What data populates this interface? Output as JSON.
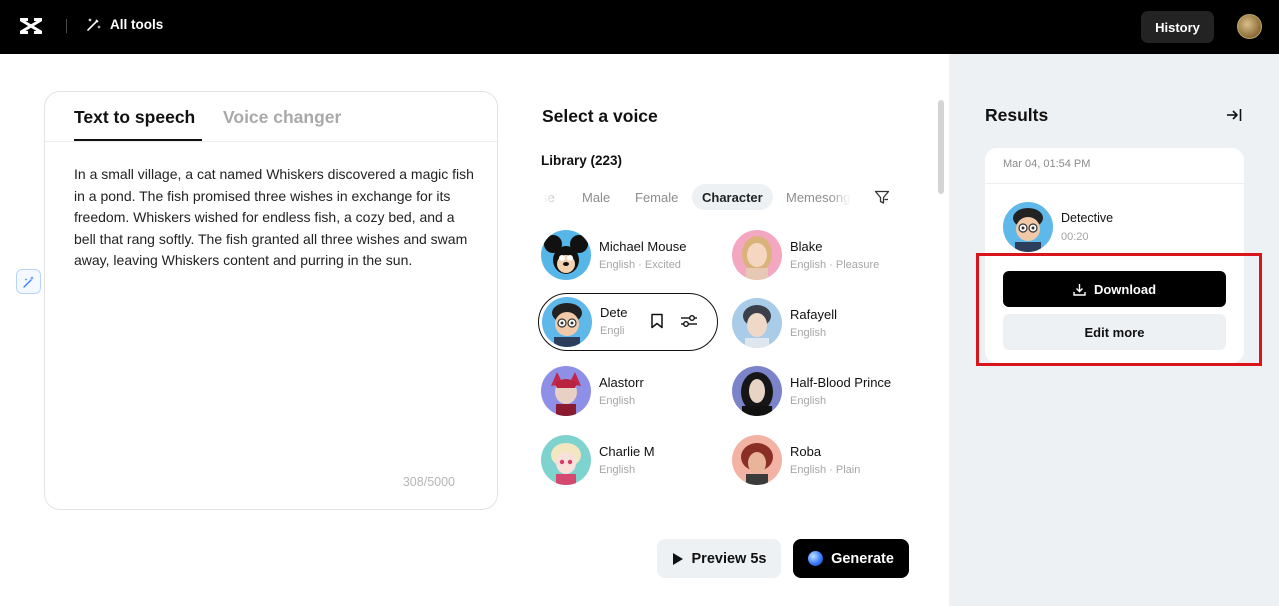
{
  "header": {
    "all_tools_label": "All tools",
    "history_label": "History",
    "logo_icon": "capcut-logo-icon",
    "all_tools_icon": "magic-wand-icon"
  },
  "editor": {
    "tabs": [
      {
        "label": "Text to speech",
        "active": true
      },
      {
        "label": "Voice changer",
        "active": false
      }
    ],
    "text": "In a small village, a cat named Whiskers discovered a magic fish in a pond. The fish promised three wishes in exchange for its freedom. Whiskers wished for endless fish, a cozy bed, and a bell that rang softly. The fish granted all three wishes and swam away, leaving Whiskers content and purring in the sun.",
    "char_count": "308/5000"
  },
  "voice_selector": {
    "title": "Select a voice",
    "library_label": "Library (223)",
    "filters": [
      {
        "label": "se",
        "active": false
      },
      {
        "label": "Male",
        "active": false
      },
      {
        "label": "Female",
        "active": false
      },
      {
        "label": "Character",
        "active": true
      },
      {
        "label": "Memesong",
        "active": false
      }
    ],
    "voices": [
      {
        "name": "Michael Mouse",
        "meta": "English · Excited"
      },
      {
        "name": "Blake",
        "meta": "English · Pleasure"
      },
      {
        "name": "Dete",
        "meta": "Engli",
        "selected": true
      },
      {
        "name": "Rafayell",
        "meta": "English"
      },
      {
        "name": "Alastorr",
        "meta": "English"
      },
      {
        "name": "Half-Blood Prince",
        "meta": "English"
      },
      {
        "name": "Charlie M",
        "meta": "English"
      },
      {
        "name": "Roba",
        "meta": "English · Plain"
      }
    ]
  },
  "actions": {
    "preview_label": "Preview 5s",
    "generate_label": "Generate"
  },
  "results": {
    "title": "Results",
    "card": {
      "date": "Mar 04, 01:54 PM",
      "voice_name": "Detective",
      "duration": "00:20",
      "download_label": "Download",
      "edit_label": "Edit more"
    }
  },
  "colors": {
    "accent_black": "#000000",
    "panel_bg": "#eef1f4",
    "highlight_red": "#d9141b"
  }
}
